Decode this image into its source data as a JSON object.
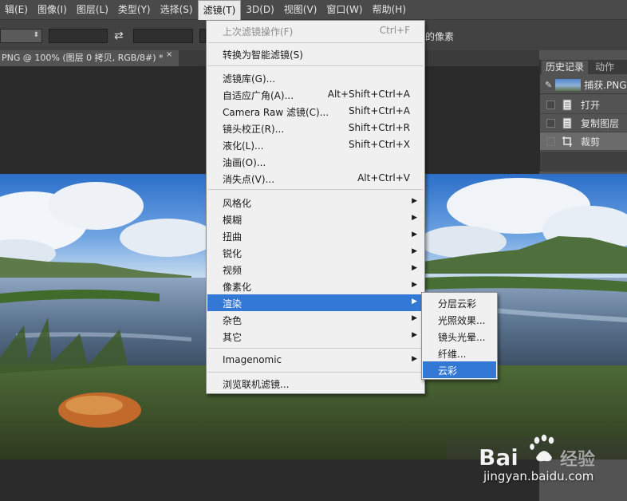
{
  "menubar": {
    "items": [
      "辑(E)",
      "图像(I)",
      "图层(L)",
      "类型(Y)",
      "选择(S)",
      "滤镜(T)",
      "3D(D)",
      "视图(V)",
      "窗口(W)",
      "帮助(H)"
    ],
    "active": "滤镜(T)"
  },
  "options": {
    "trailing_text": "的像素"
  },
  "document": {
    "tab_title": "PNG @ 100% (图层 0 拷贝, RGB/8#) *",
    "close_glyph": "×"
  },
  "history_panel": {
    "tabs": [
      "历史记录",
      "动作"
    ],
    "snapshot_label": "捕获.PNG",
    "rows": [
      {
        "label": "打开",
        "icon": "document-icon",
        "selected": false
      },
      {
        "label": "复制图层",
        "icon": "document-icon",
        "selected": false
      },
      {
        "label": "裁剪",
        "icon": "crop-icon",
        "selected": true
      }
    ]
  },
  "filter_menu": {
    "last_filter": {
      "label": "上次滤镜操作(F)",
      "shortcut": "Ctrl+F",
      "disabled": true
    },
    "convert_smart": {
      "label": "转换为智能滤镜(S)"
    },
    "group1": [
      {
        "label": "滤镜库(G)...",
        "shortcut": ""
      },
      {
        "label": "自适应广角(A)...",
        "shortcut": "Alt+Shift+Ctrl+A"
      },
      {
        "label": "Camera Raw 滤镜(C)...",
        "shortcut": "Shift+Ctrl+A"
      },
      {
        "label": "镜头校正(R)...",
        "shortcut": "Shift+Ctrl+R"
      },
      {
        "label": "液化(L)...",
        "shortcut": "Shift+Ctrl+X"
      },
      {
        "label": "油画(O)...",
        "shortcut": ""
      },
      {
        "label": "消失点(V)...",
        "shortcut": "Alt+Ctrl+V"
      }
    ],
    "group2": [
      {
        "label": "风格化",
        "highlighted": false
      },
      {
        "label": "模糊",
        "highlighted": false
      },
      {
        "label": "扭曲",
        "highlighted": false
      },
      {
        "label": "锐化",
        "highlighted": false
      },
      {
        "label": "视频",
        "highlighted": false
      },
      {
        "label": "像素化",
        "highlighted": false
      },
      {
        "label": "渲染",
        "highlighted": true
      },
      {
        "label": "杂色",
        "highlighted": false
      },
      {
        "label": "其它",
        "highlighted": false
      }
    ],
    "imagenomic": {
      "label": "Imagenomic"
    },
    "browse_online": {
      "label": "浏览联机滤镜..."
    },
    "submenu_arrow": "▶"
  },
  "render_submenu": {
    "items": [
      {
        "label": "分层云彩",
        "highlighted": false
      },
      {
        "label": "光照效果...",
        "highlighted": false
      },
      {
        "label": "镜头光晕...",
        "highlighted": false
      },
      {
        "label": "纤维...",
        "highlighted": false
      },
      {
        "label": "云彩",
        "highlighted": true
      }
    ]
  },
  "watermark": {
    "url_text": "jingyan.baidu.com"
  },
  "colors": {
    "menu_highlight": "#3478d6",
    "menu_background": "#f0f0f0",
    "app_dark": "#2b2b2b",
    "panel": "#535353"
  }
}
